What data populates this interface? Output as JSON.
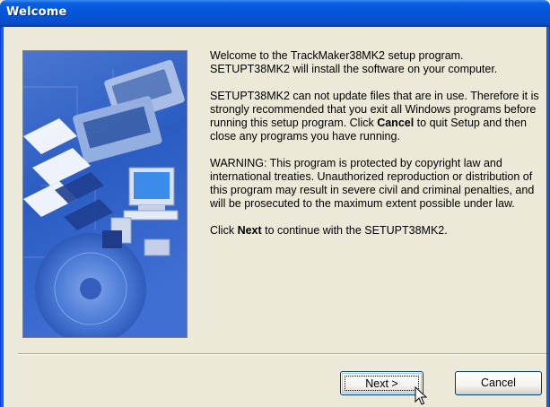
{
  "window": {
    "title": "Welcome"
  },
  "content": {
    "para1": "Welcome to the TrackMaker38MK2 setup program. SETUPT38MK2 will install the software on your computer.",
    "para2_before": "SETUPT38MK2 can not update files that are in use. Therefore it is strongly recommended that you exit all Windows programs before running this setup program.  Click ",
    "para2_bold": "Cancel",
    "para2_after": " to quit Setup and then close any programs you have running.",
    "para3": "WARNING:  This program is protected by copyright law and international treaties.  Unauthorized reproduction or distribution of this program may result in severe civil and criminal penalties, and will be prosecuted to the maximum extent possible under law.",
    "para4_before": "Click ",
    "para4_bold": "Next",
    "para4_after": " to continue with the SETUPT38MK2."
  },
  "buttons": {
    "next_label": "Next >",
    "cancel_label": "Cancel"
  },
  "icons": {
    "cursor": "arrow-cursor-icon",
    "banner": "setup-banner-image"
  },
  "colors": {
    "titlebar": "#0454d8",
    "dialog_bg": "#ece9d8",
    "banner_bg": "#2f5fc4"
  }
}
